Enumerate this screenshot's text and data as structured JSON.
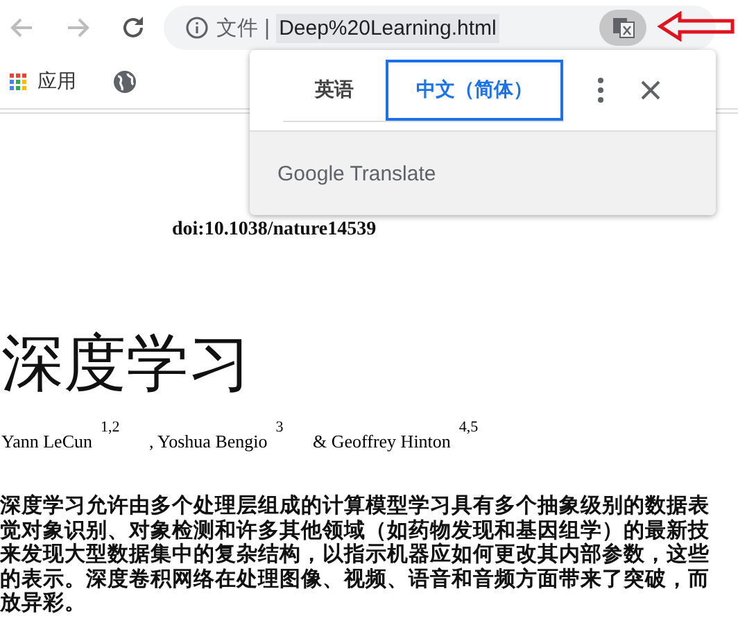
{
  "toolbar": {
    "address": {
      "security_label": "文件",
      "separator": "|",
      "url": "Deep%20Learning.html"
    }
  },
  "bookmarks": [
    {
      "kind": "apps",
      "label": "应用"
    },
    {
      "kind": "globe"
    }
  ],
  "translate_popup": {
    "tabs": [
      {
        "label": "英语",
        "selected": false
      },
      {
        "label": "中文（简体）",
        "selected": true
      }
    ],
    "branding": "Google Translate"
  },
  "article": {
    "doi": "doi:10.1038/nature14539",
    "title": "深度学习",
    "authors": [
      {
        "name": "Yann LeCun",
        "affiliation": "1,2"
      },
      {
        "name": "Yoshua Bengio",
        "affiliation": "3",
        "joiner": ","
      },
      {
        "name": "Geoffrey Hinton",
        "affiliation": "4,5",
        "joiner": "&"
      }
    ],
    "abstract_lines": [
      "深度学习允许由多个处理层组成的计算模型学习具有多个抽象级别的数据表",
      "觉对象识别、对象检测和许多其他领域（如药物发现和基因组学）的最新技",
      "来发现大型数据集中的复杂结构，以指示机器应如何更改其内部参数，这些",
      "的表示。深度卷积网络在处理图像、视频、语音和音频方面带来了突破，而",
      "放异彩。"
    ]
  }
}
